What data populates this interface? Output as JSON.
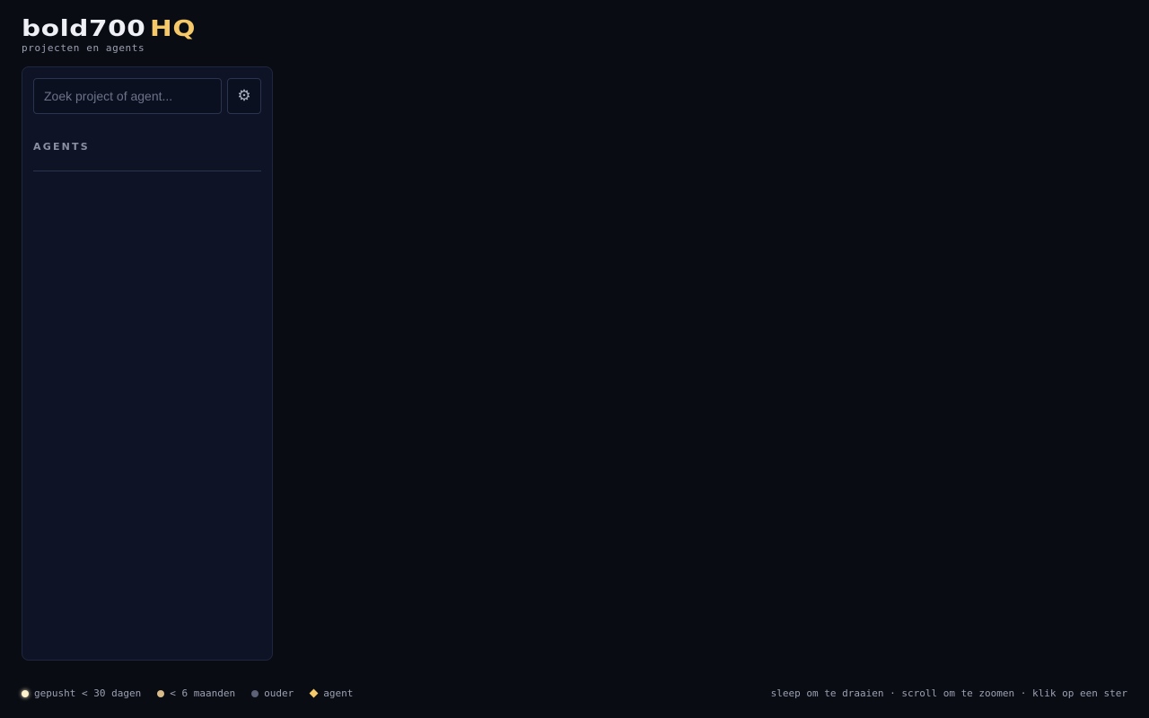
{
  "header": {
    "title": "bold700",
    "title_accent": "HQ",
    "subtitle": "projecten en agents"
  },
  "sidebar": {
    "search": {
      "placeholder": "Zoek project of agent...",
      "value": ""
    },
    "settings_icon": "gear-icon",
    "section_title": "AGENTS",
    "agents": []
  },
  "legend": {
    "items": [
      {
        "icon": "dot-recent",
        "label": "gepusht < 30 dagen",
        "color": "#fff2cc"
      },
      {
        "icon": "dot-months",
        "label": "< 6 maanden",
        "color": "#d9bb8a"
      },
      {
        "icon": "dot-older",
        "label": "ouder",
        "color": "#5c6178"
      },
      {
        "icon": "diamond",
        "label": "agent",
        "color": "#f5c86a"
      }
    ]
  },
  "hint": "sleep om te draaien · scroll om te zoomen · klik op een ster",
  "colors": {
    "background": "#0a0c14",
    "panel": "#0e1325",
    "accent": "#f5c86a"
  }
}
